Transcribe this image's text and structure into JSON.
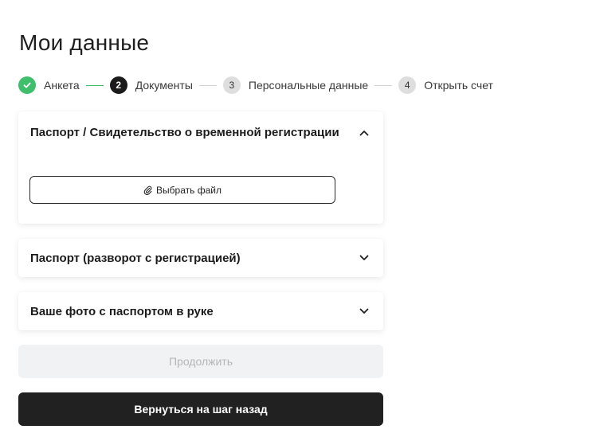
{
  "page": {
    "title": "Мои данные"
  },
  "stepper": {
    "steps": [
      {
        "number": "",
        "label": "Анкета",
        "state": "done"
      },
      {
        "number": "2",
        "label": "Документы",
        "state": "active"
      },
      {
        "number": "3",
        "label": "Персональные данные",
        "state": "pending"
      },
      {
        "number": "4",
        "label": "Открыть счет",
        "state": "pending"
      }
    ],
    "colors": {
      "done": "#3fbf6b",
      "active": "#1b1b1b",
      "pending": "#dedede"
    }
  },
  "documents": {
    "sections": [
      {
        "title": "Паспорт / Свидетельство о временной регистрации",
        "expanded": true,
        "icon": "chevron-up-icon"
      },
      {
        "title": "Паспорт (разворот с регистрацией)",
        "expanded": false,
        "icon": "chevron-down-icon"
      },
      {
        "title": "Ваше фото с паспортом в руке",
        "expanded": false,
        "icon": "chevron-down-icon"
      }
    ],
    "file_button": {
      "label": "Выбрать файл",
      "icon": "paperclip-icon"
    }
  },
  "actions": {
    "continue_label": "Продолжить",
    "continue_disabled": true,
    "back_label": "Вернуться на шаг назад"
  }
}
